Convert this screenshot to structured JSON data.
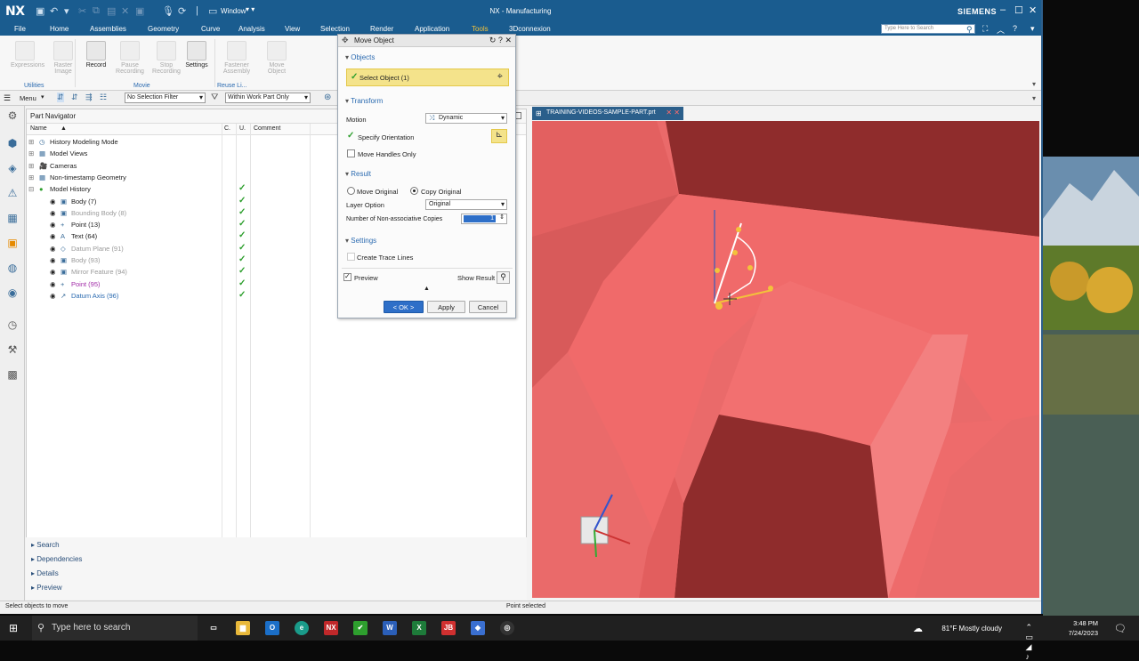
{
  "app": {
    "logo": "NX",
    "window_menu": "Window",
    "title": "NX - Manufacturing",
    "brand": "SIEMENS"
  },
  "ribbon_tabs": [
    "File",
    "Home",
    "Assemblies",
    "Geometry",
    "Curve",
    "Analysis",
    "View",
    "Selection",
    "Render",
    "Application",
    "Tools",
    "3Dconnexion"
  ],
  "ribbon_active_tab": "Tools",
  "ribbon_search_placeholder": "Type Here to Search",
  "ribbon": {
    "buttons": [
      {
        "label": "Expressions",
        "enabled": false
      },
      {
        "label": "Raster Image",
        "enabled": false
      },
      {
        "label": "Record",
        "enabled": true
      },
      {
        "label": "Pause Recording",
        "enabled": false
      },
      {
        "label": "Stop Recording",
        "enabled": false
      },
      {
        "label": "Settings",
        "enabled": true
      },
      {
        "label": "Fastener Assembly",
        "enabled": false
      },
      {
        "label": "Move Object",
        "enabled": false
      }
    ],
    "groups": [
      "Utilities",
      "Movie",
      "Reuse Li..."
    ]
  },
  "selection_bar": {
    "menu_label": "Menu",
    "filter": "No Selection Filter",
    "scope": "Within Work Part Only"
  },
  "part_navigator": {
    "title": "Part Navigator",
    "columns": [
      "Name",
      "C.",
      "U.",
      "Comment"
    ],
    "rows": [
      {
        "label": "History Modeling Mode",
        "indent": 0,
        "style": "",
        "check": false
      },
      {
        "label": "Model Views",
        "indent": 0,
        "style": "",
        "check": false
      },
      {
        "label": "Cameras",
        "indent": 0,
        "style": "",
        "check": false
      },
      {
        "label": "Non-timestamp Geometry",
        "indent": 0,
        "style": "",
        "check": false
      },
      {
        "label": "Model History",
        "indent": 0,
        "style": "",
        "check": true
      },
      {
        "label": "Body (7)",
        "indent": 1,
        "style": "",
        "check": true
      },
      {
        "label": "Bounding Body (8)",
        "indent": 1,
        "style": "dim",
        "check": true
      },
      {
        "label": "Point (13)",
        "indent": 1,
        "style": "",
        "check": true
      },
      {
        "label": "Text (64)",
        "indent": 1,
        "style": "",
        "check": true
      },
      {
        "label": "Datum Plane (91)",
        "indent": 1,
        "style": "dim",
        "check": true
      },
      {
        "label": "Body (93)",
        "indent": 1,
        "style": "dim",
        "check": true
      },
      {
        "label": "Mirror Feature (94)",
        "indent": 1,
        "style": "dim",
        "check": true
      },
      {
        "label": "Point (95)",
        "indent": 1,
        "style": "purple",
        "check": true
      },
      {
        "label": "Datum Axis (96)",
        "indent": 1,
        "style": "blue",
        "check": true
      }
    ]
  },
  "bottom_panels": [
    "Search",
    "Dependencies",
    "Details",
    "Preview"
  ],
  "dialog": {
    "title": "Move Object",
    "objects_section": "Objects",
    "select_object": "Select Object (1)",
    "transform_section": "Transform",
    "motion_label": "Motion",
    "motion_value": "Dynamic",
    "specify_orientation": "Specify Orientation",
    "move_handles_only": "Move Handles Only",
    "result_section": "Result",
    "move_original": "Move Original",
    "copy_original": "Copy Original",
    "layer_option_label": "Layer Option",
    "layer_option_value": "Original",
    "copies_label": "Number of Non-associative Copies",
    "copies_value": "1",
    "settings_section": "Settings",
    "create_trace_lines": "Create Trace Lines",
    "preview_label": "Preview",
    "show_result": "Show Result",
    "ok_label": "< OK >",
    "apply_label": "Apply",
    "cancel_label": "Cancel"
  },
  "viewport_tab": "TRAINING-VIDEOS-SAMPLE-PART.prt",
  "status": {
    "left": "Select objects to move",
    "center": "Point selected"
  },
  "taskbar": {
    "search_placeholder": "Type here to search",
    "weather": "81°F  Mostly cloudy",
    "time": "3:48 PM",
    "date": "7/24/2023"
  },
  "colors": {
    "title_blue": "#1a5c8f",
    "accent_yellow": "#f3c23b",
    "part_red": "#e86464",
    "check_green": "#2e9f2e"
  }
}
